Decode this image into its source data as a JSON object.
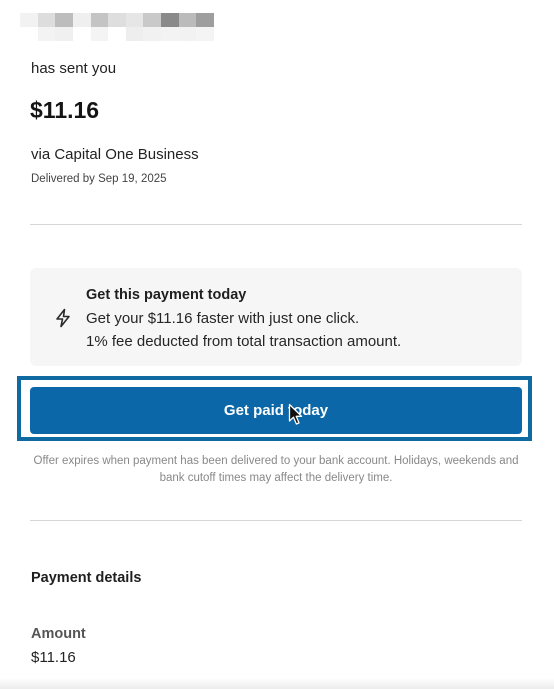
{
  "sender": {
    "name_redacted": true,
    "sent_text": "has sent you"
  },
  "payment": {
    "amount": "$11.16",
    "via": "via Capital One Business",
    "delivered_by": "Delivered by Sep 19, 2025"
  },
  "offer": {
    "icon": "lightning-bolt-icon",
    "title": "Get this payment today",
    "line1": "Get your $11.16 faster with just one click.",
    "line2": "1% fee deducted from total transaction amount.",
    "button_label": "Get paid today",
    "fine_print": "Offer expires when payment has been delivered to your bank account. Holidays, weekends and bank cutoff times may affect the delivery time."
  },
  "details": {
    "title": "Payment details",
    "amount_label": "Amount",
    "amount_value": "$11.16"
  },
  "colors": {
    "button": "#0b67a8",
    "highlight": "#0f6aa1",
    "offer_bg": "#f6f6f6"
  }
}
